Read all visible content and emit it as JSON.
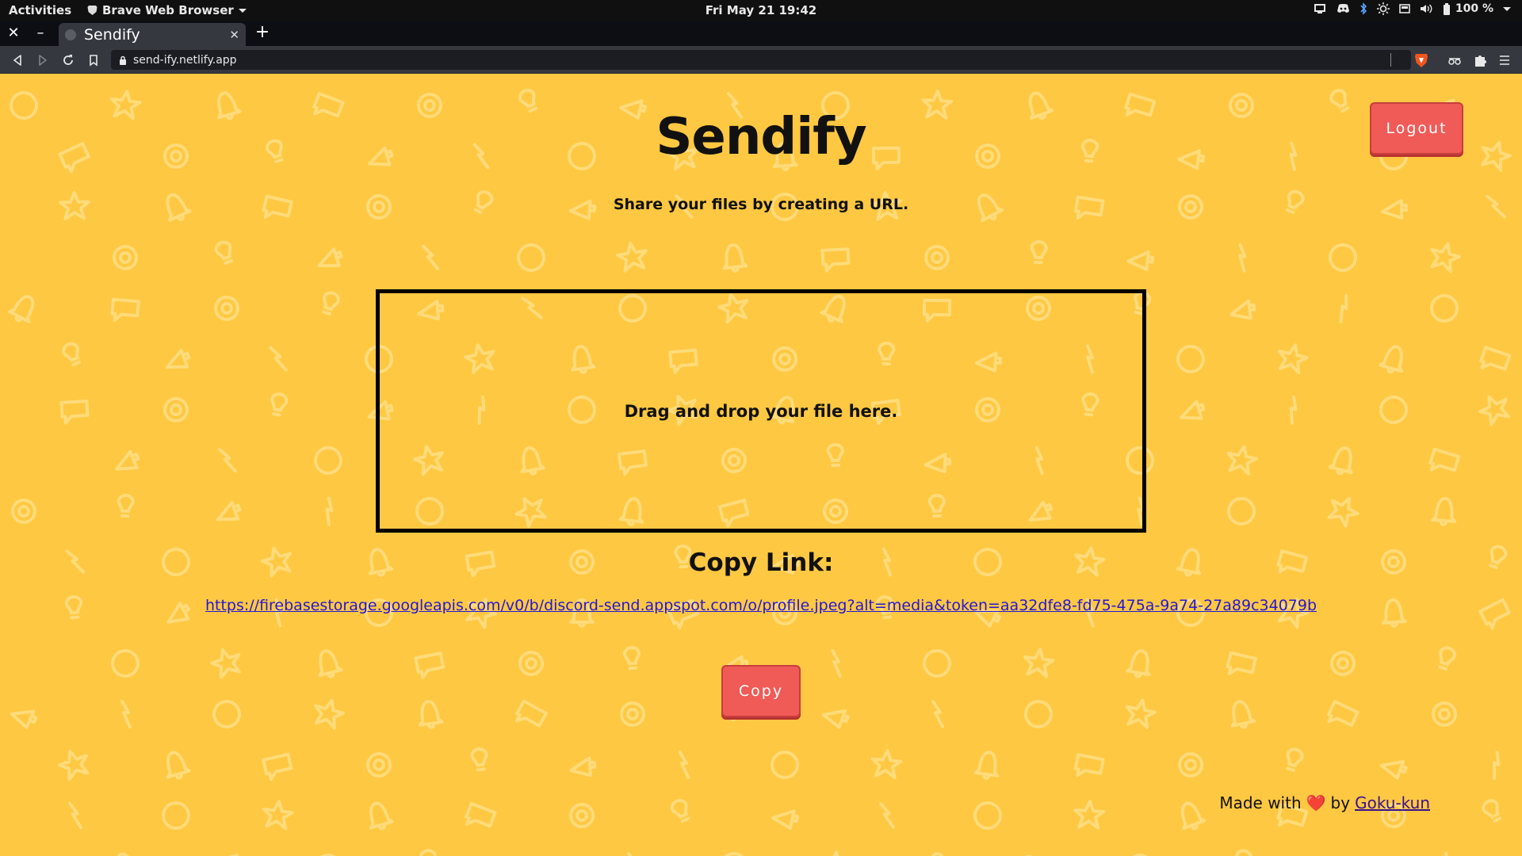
{
  "system_bar": {
    "activities": "Activities",
    "app_name": "Brave Web Browser",
    "clock": "Fri May 21  19:42",
    "battery": "100 %",
    "tray_icons": [
      "monitor-icon",
      "discord-icon",
      "bluetooth-icon",
      "brightness-icon",
      "display-icon",
      "volume-icon",
      "battery-icon"
    ]
  },
  "browser": {
    "tab_title": "Sendify",
    "url": "send-ify.netlify.app"
  },
  "page": {
    "title": "Sendify",
    "tagline": "Share your files by creating a URL.",
    "logout_label": "Logout",
    "dropzone_text": "Drag and drop your file here.",
    "copy_heading": "Copy Link:",
    "link": "https://firebasestorage.googleapis.com/v0/b/discord-send.appspot.com/o/profile.jpeg?alt=media&token=aa32dfe8-fd75-475a-9a74-27a89c34079b",
    "copy_label": "Copy",
    "footer_prefix": "Made with",
    "footer_heart": "❤️",
    "footer_by": "by",
    "footer_author": "Goku-kun"
  },
  "colors": {
    "page_background": "#ffc842",
    "button": "#f05a57",
    "link": "#2416d9"
  }
}
